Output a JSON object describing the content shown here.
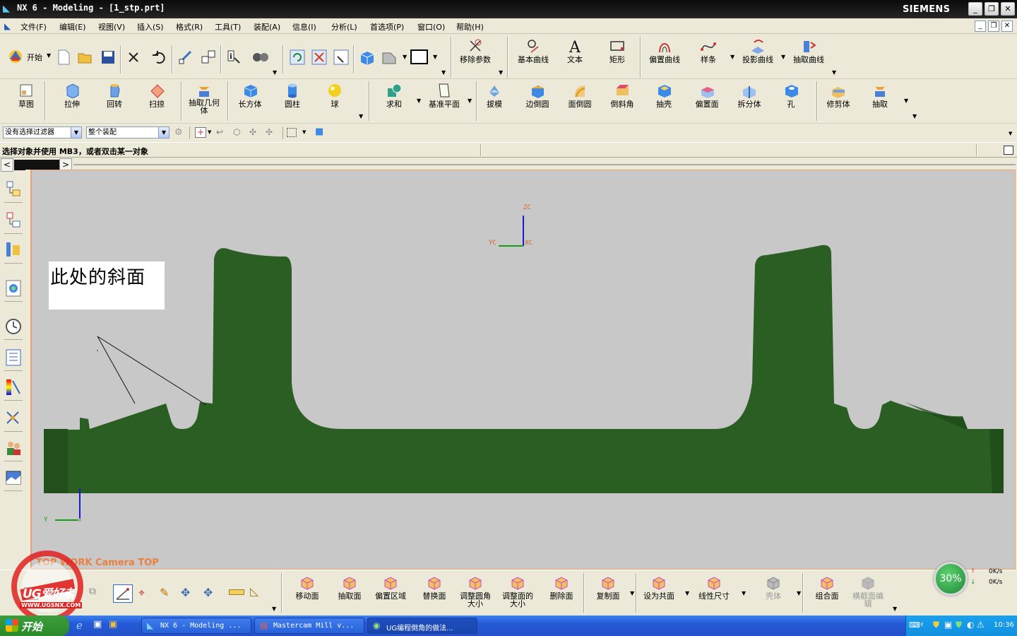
{
  "window": {
    "title": "NX 6 - Modeling - [1_stp.prt]",
    "brand": "SIEMENS"
  },
  "menubar": {
    "items": [
      "文件(F)",
      "编辑(E)",
      "视图(V)",
      "插入(S)",
      "格式(R)",
      "工具(T)",
      "装配(A)",
      "信息(I)",
      "分析(L)",
      "首选项(P)",
      "窗口(O)",
      "帮助(H)"
    ]
  },
  "toolbar1": {
    "start_label": "开始",
    "right_items": [
      "移除参数",
      "基本曲线",
      "文本",
      "矩形",
      "偏置曲线",
      "样条",
      "投影曲线",
      "抽取曲线"
    ]
  },
  "toolbar2": {
    "items": [
      "草图",
      "拉伸",
      "回转",
      "扫掠",
      "抽取几何体",
      "长方体",
      "圆柱",
      "球",
      "求和",
      "基准平面",
      "拔模",
      "边倒圆",
      "面倒圆",
      "倒斜角",
      "抽壳",
      "偏置面",
      "拆分体",
      "孔",
      "修剪体",
      "抽取"
    ]
  },
  "selection": {
    "filter": "没有选择过滤器",
    "scope": "整个装配"
  },
  "status": {
    "prompt": "选择对象并使用 MB3，或者双击某一对象"
  },
  "viewport": {
    "annotation": "此处的斜面",
    "camera_label": "TOP WORK Camera TOP",
    "axes": {
      "zc": "ZC",
      "yc": "YC",
      "xc": "XC",
      "y": "Y"
    },
    "part_color": "#2a5e22",
    "background_color": "#c8c8c8"
  },
  "bottombar": {
    "items": [
      "移动面",
      "抽取面",
      "偏置区域",
      "替换面",
      "调整圆角大小",
      "调整面的大小",
      "删除面",
      "复制面",
      "设为共面",
      "线性尺寸",
      "壳体",
      "组合面",
      "横截面编辑"
    ],
    "disabled": [
      "壳体",
      "横截面编辑"
    ],
    "progress_percent": 30,
    "net_up": "0K/s",
    "net_down": "0K/s",
    "watermark": "UG爱好者",
    "watermark_url": "WWW.UGSNX.COM"
  },
  "taskbar": {
    "start_label": "开始",
    "tasks": [
      "NX 6 - Modeling ...",
      "Mastercam Mill v...",
      "UG编程倒角的做法..."
    ],
    "clock": "10:36"
  }
}
